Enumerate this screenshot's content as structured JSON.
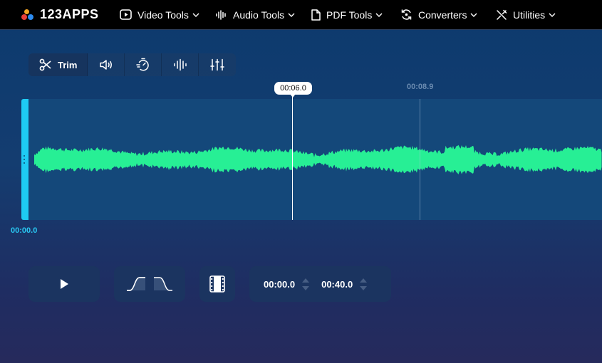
{
  "app": {
    "logo_text": "123APPS"
  },
  "nav": {
    "items": [
      {
        "label": "Video Tools",
        "icon": "play-box-icon"
      },
      {
        "label": "Audio Tools",
        "icon": "audio-wave-icon"
      },
      {
        "label": "PDF Tools",
        "icon": "document-icon"
      },
      {
        "label": "Converters",
        "icon": "convert-cycle-icon"
      },
      {
        "label": "Utilities",
        "icon": "tools-icon"
      }
    ]
  },
  "tools": {
    "active_label": "Trim",
    "tabs": [
      "scissors-icon",
      "volume-icon",
      "speed-icon",
      "equalizer-wave-icon",
      "sliders-icon"
    ]
  },
  "timeline": {
    "playhead_time": "00:06.0",
    "hover_time": "00:08.9",
    "start_time": "00:00.0"
  },
  "controls": {
    "start_value": "00:00.0",
    "end_value": "00:40.0"
  },
  "colors": {
    "waveform": "#27ef95",
    "handle": "#1ecbf3",
    "nav_bg": "#000000"
  }
}
